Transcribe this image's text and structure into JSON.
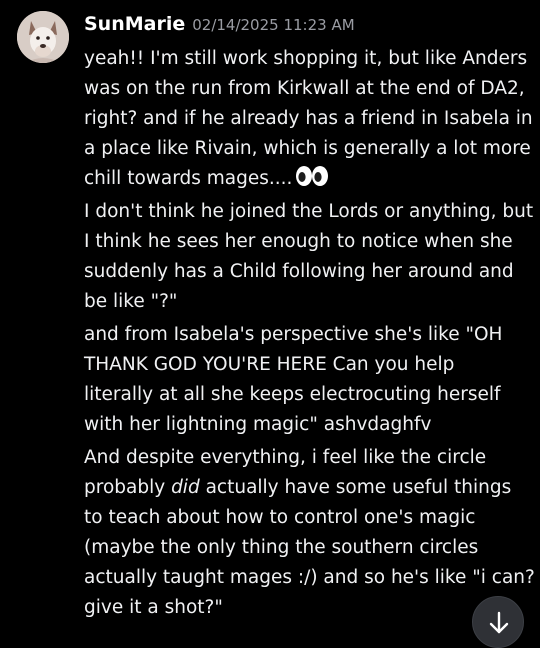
{
  "message": {
    "username": "SunMarie",
    "timestamp": "02/14/2025 11:23 AM",
    "avatar_icon": "dog-avatar",
    "paragraphs": [
      {
        "lines": [
          "yeah!! I'm still work shopping it, but like Anders",
          "was on the run from Kirkwall at the end of DA2,",
          "right? and if he already has a friend in Isabela in",
          "a place like Rivain, which is generally a lot more",
          "chill towards mages...."
        ],
        "trailing_emoji": "eyes-emoji"
      },
      {
        "lines": [
          "I don't think he joined the Lords or anything, but",
          "I think he sees her enough to notice when she",
          "suddenly has a Child following her around and",
          "be like \"?\""
        ]
      },
      {
        "lines": [
          "and from Isabela's perspective she's like \"OH",
          "THANK GOD YOU'RE HERE Can you help",
          "literally at all she keeps electrocuting herself",
          "with her lightning magic\" ashvdaghfv"
        ]
      },
      {
        "lines": [
          "And despite everything, i feel like the circle",
          "probably ",
          "to teach about how to control one's magic",
          "(maybe the only thing the southern circles",
          "actually taught mages :/) and so he's like \"i can?",
          "give it a shot?\""
        ],
        "italic_word": "did",
        "line2_rest": " actually have some useful things"
      }
    ]
  },
  "jump_button_icon": "arrow-down-icon",
  "colors": {
    "background": "#000000",
    "text": "#f0f1f3",
    "timestamp": "#9a9ca3",
    "button": "#2f3136"
  }
}
